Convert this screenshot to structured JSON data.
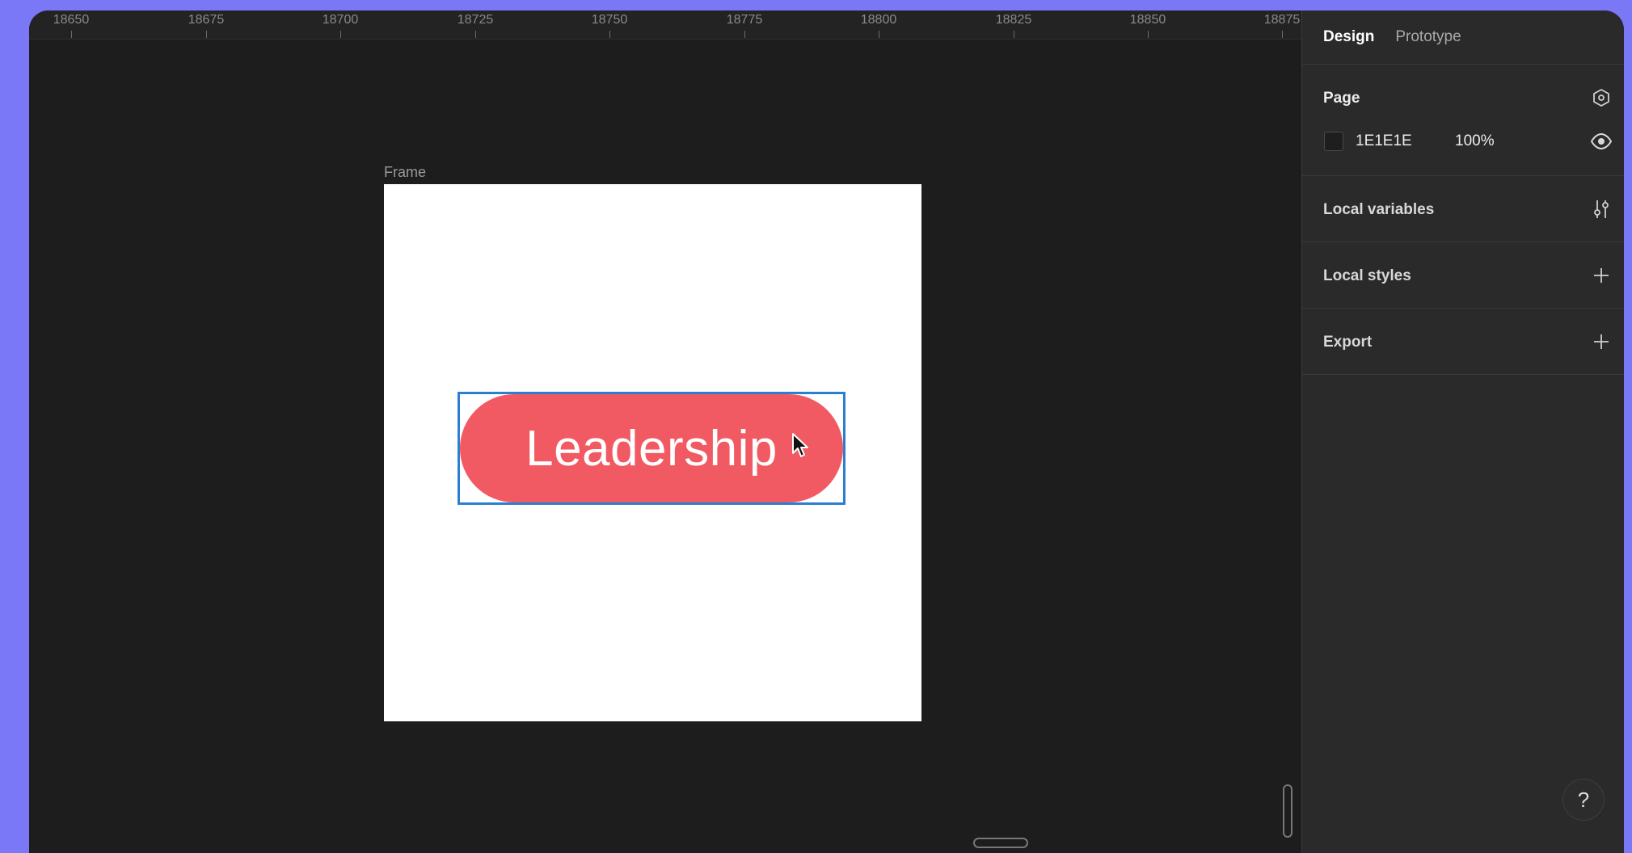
{
  "ruler": {
    "labels": [
      "18650",
      "18675",
      "18700",
      "18725",
      "18750",
      "18775",
      "18800",
      "18825",
      "18850",
      "18875"
    ]
  },
  "canvas": {
    "frame_label": "Frame",
    "button_text": "Leadership",
    "button_color": "#f25a63",
    "selection_color": "#2c7fd0"
  },
  "panel": {
    "tabs": [
      {
        "label": "Design",
        "active": true
      },
      {
        "label": "Prototype",
        "active": false
      }
    ],
    "page": {
      "title": "Page",
      "color_hex": "1E1E1E",
      "opacity": "100%",
      "icon": "page-settings-icon"
    },
    "local_variables": {
      "title": "Local variables",
      "icon": "sliders-icon"
    },
    "local_styles": {
      "title": "Local styles",
      "icon": "plus-icon"
    },
    "export": {
      "title": "Export",
      "icon": "plus-icon"
    }
  },
  "help": {
    "label": "?"
  }
}
